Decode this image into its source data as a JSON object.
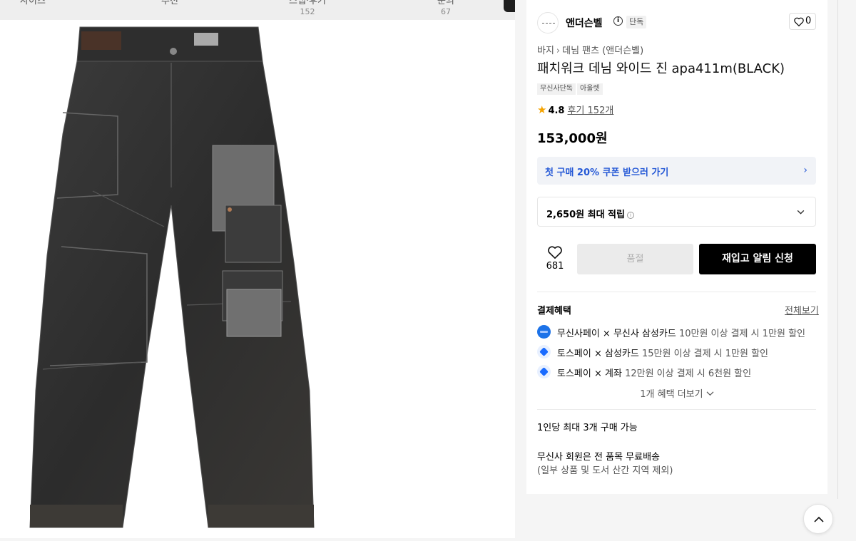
{
  "tabs": [
    {
      "label": "사이즈",
      "count": ""
    },
    {
      "label": "추천",
      "count": ""
    },
    {
      "label": "스냅·후기",
      "count": "152"
    },
    {
      "label": "문의",
      "count": "67"
    }
  ],
  "product_image": {
    "icon": "denim-pants-image"
  },
  "brand": {
    "name": "앤더슨벨",
    "info_icon": "i",
    "badge": "단독",
    "like_count": "0"
  },
  "breadcrumb": [
    "바지",
    "데님 팬츠 (앤더슨벨)"
  ],
  "title": "패치워크 데님 와이드 진 apa411m(BLACK)",
  "tags": [
    "무신사단독",
    "아울렛"
  ],
  "rating": {
    "score": "4.8",
    "reviews": "후기 152개"
  },
  "price": "153,000원",
  "coupon": {
    "label": "첫 구매 20% 쿠폰 받으러 가기",
    "accent": "#2458d6"
  },
  "points": {
    "label": "2,650원 최대 적립"
  },
  "actions": {
    "wish_count": "681",
    "soldout": "품절",
    "restock": "재입고 알림 신청"
  },
  "benefits": {
    "title": "결제혜택",
    "view_all": "전체보기",
    "items": [
      {
        "strong": "무신사페이 × 무신사 삼성카드",
        "detail": "10만원 이상 결제 시 1만원 할인"
      },
      {
        "strong": "토스페이 × 삼성카드",
        "detail": "15만원 이상 결제 시 1만원 할인"
      },
      {
        "strong": "토스페이 × 계좌",
        "detail": "12만원 이상 결제 시 6천원 할인"
      }
    ],
    "more": "1개 혜택 더보기"
  },
  "limit": "1인당 최대 3개 구매 가능",
  "shipping": {
    "line1": "무신사 회원은 전 품목 무료배송",
    "line2": "(일부 상품 및 도서 산간 지역 제외)"
  }
}
